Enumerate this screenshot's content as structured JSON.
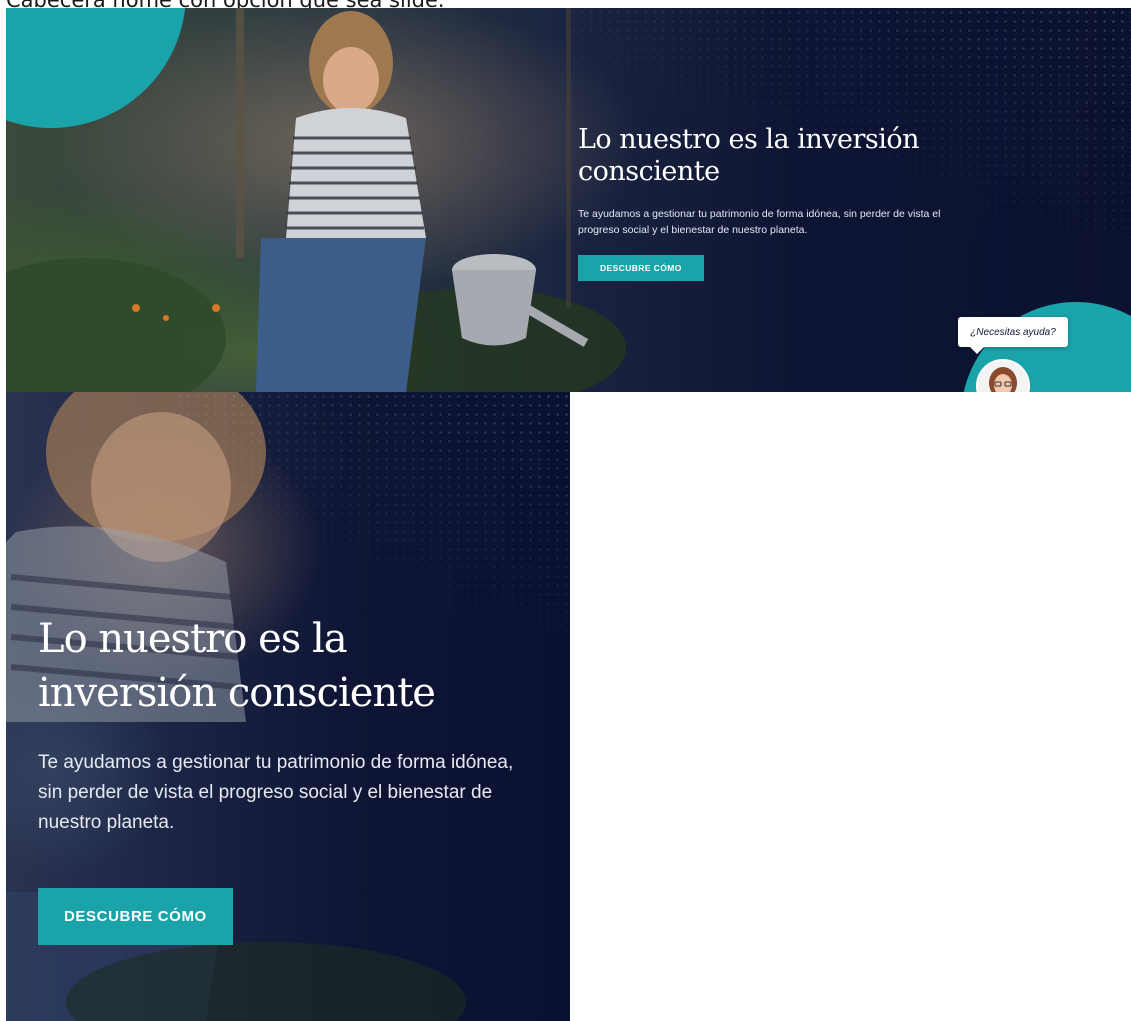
{
  "caption": "Cabecera home con opción que sea slide.",
  "desktop": {
    "title": "Lo nuestro es la inversión consciente",
    "subtitle": "Te ayudamos a gestionar tu patrimonio de forma idónea, sin perder de vista el progreso social y el bienestar de nuestro planeta.",
    "cta_label": "DESCUBRE CÓMO",
    "help_text": "¿Necesitas ayuda?"
  },
  "mobile": {
    "title_line1": "Lo nuestro es la",
    "title_line2": "inversión consciente",
    "subtitle": "Te ayudamos a gestionar tu patrimonio de forma idónea, sin perder de vista el progreso social y el bienestar de nuestro planeta.",
    "cta_label": "DESCUBRE CÓMO"
  },
  "colors": {
    "accent_teal": "#1aa4aa",
    "navy": "#0c1330",
    "text_light": "#ffffff"
  },
  "icons": [
    "avatar-icon",
    "dotted-pattern"
  ]
}
